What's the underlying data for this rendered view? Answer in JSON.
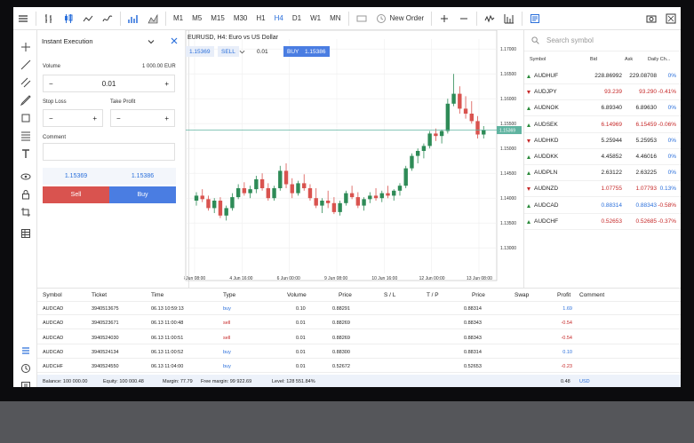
{
  "toolbar": {
    "timeframes": [
      "M1",
      "M5",
      "M15",
      "M30",
      "H1",
      "H4",
      "D1",
      "W1",
      "MN"
    ],
    "active_timeframe": "H4",
    "new_order": "New Order"
  },
  "order_panel": {
    "mode": "Instant Execution",
    "volume_label": "Volume",
    "volume_amount": "1 000.00 EUR",
    "volume_value": "0.01",
    "stop_loss_label": "Stop Loss",
    "take_profit_label": "Take Profit",
    "comment_label": "Comment",
    "bid": "1.15369",
    "ask": "1.15386",
    "sell_label": "Sell",
    "buy_label": "Buy"
  },
  "chart": {
    "title": "EURUSD, H4: Euro vs US Dollar",
    "sell_price": "1.15369",
    "sell_label": "SELL",
    "volume": "0.01",
    "buy_label": "BUY",
    "buy_price": "1.15386",
    "current_price_tag": "1.15369"
  },
  "chart_data": {
    "type": "candlestick",
    "title": "EURUSD, H4: Euro vs US Dollar",
    "y_ticks": [
      "1.17000",
      "1.16500",
      "1.16000",
      "1.15500",
      "1.15000",
      "1.14500",
      "1.14000",
      "1.13500",
      "1.13000"
    ],
    "x_ticks": [
      "3 Jun 08:00",
      "4 Jun 16:00",
      "6 Jun 00:00",
      "9 Jun 08:00",
      "10 Jun 16:00",
      "12 Jun 00:00",
      "13 Jun 08:00"
    ],
    "ylim": [
      1.127,
      1.172
    ],
    "candles": [
      [
        1.1395,
        1.1412,
        1.1385,
        1.1405
      ],
      [
        1.1405,
        1.1418,
        1.1392,
        1.1398
      ],
      [
        1.1398,
        1.1405,
        1.1375,
        1.138
      ],
      [
        1.138,
        1.14,
        1.137,
        1.1395
      ],
      [
        1.1395,
        1.1402,
        1.136,
        1.1365
      ],
      [
        1.1365,
        1.1385,
        1.1355,
        1.138
      ],
      [
        1.138,
        1.141,
        1.1375,
        1.1402
      ],
      [
        1.1402,
        1.1428,
        1.1398,
        1.142
      ],
      [
        1.142,
        1.1432,
        1.1405,
        1.141
      ],
      [
        1.141,
        1.1425,
        1.14,
        1.1418
      ],
      [
        1.1418,
        1.1445,
        1.141,
        1.1438
      ],
      [
        1.1438,
        1.145,
        1.1415,
        1.142
      ],
      [
        1.142,
        1.143,
        1.1395,
        1.14
      ],
      [
        1.14,
        1.1425,
        1.1395,
        1.142
      ],
      [
        1.142,
        1.1465,
        1.1415,
        1.1455
      ],
      [
        1.1455,
        1.147,
        1.142,
        1.1428
      ],
      [
        1.1428,
        1.144,
        1.14,
        1.141
      ],
      [
        1.141,
        1.1435,
        1.1405,
        1.143
      ],
      [
        1.143,
        1.1448,
        1.1415,
        1.142
      ],
      [
        1.142,
        1.1428,
        1.1395,
        1.14
      ],
      [
        1.14,
        1.142,
        1.138,
        1.1385
      ],
      [
        1.1385,
        1.14,
        1.137,
        1.1395
      ],
      [
        1.1395,
        1.1415,
        1.138,
        1.139
      ],
      [
        1.139,
        1.1402,
        1.1368,
        1.1372
      ],
      [
        1.1372,
        1.1395,
        1.1365,
        1.139
      ],
      [
        1.139,
        1.1415,
        1.1385,
        1.141
      ],
      [
        1.141,
        1.1425,
        1.1398,
        1.1402
      ],
      [
        1.1402,
        1.1412,
        1.138,
        1.1385
      ],
      [
        1.1385,
        1.1402,
        1.1375,
        1.1398
      ],
      [
        1.1398,
        1.1412,
        1.139,
        1.1405
      ],
      [
        1.1405,
        1.142,
        1.1395,
        1.14
      ],
      [
        1.14,
        1.1415,
        1.1392,
        1.141
      ],
      [
        1.141,
        1.1425,
        1.14,
        1.1405
      ],
      [
        1.1405,
        1.1418,
        1.1395,
        1.1415
      ],
      [
        1.1415,
        1.143,
        1.1405,
        1.1425
      ],
      [
        1.1425,
        1.1465,
        1.142,
        1.146
      ],
      [
        1.146,
        1.149,
        1.1455,
        1.1485
      ],
      [
        1.1485,
        1.15,
        1.147,
        1.1495
      ],
      [
        1.1495,
        1.151,
        1.148,
        1.1505
      ],
      [
        1.1505,
        1.1535,
        1.15,
        1.153
      ],
      [
        1.153,
        1.154,
        1.1515,
        1.1525
      ],
      [
        1.1525,
        1.1538,
        1.151,
        1.1535
      ],
      [
        1.1535,
        1.16,
        1.153,
        1.159
      ],
      [
        1.159,
        1.165,
        1.1585,
        1.161
      ],
      [
        1.161,
        1.1625,
        1.157,
        1.158
      ],
      [
        1.158,
        1.1605,
        1.156,
        1.157
      ],
      [
        1.157,
        1.1595,
        1.155,
        1.1555
      ],
      [
        1.1555,
        1.1565,
        1.152,
        1.1528
      ],
      [
        1.1528,
        1.1545,
        1.152,
        1.1537
      ]
    ]
  },
  "watchlist": {
    "search_placeholder": "Search symbol",
    "headers": [
      "Symbol",
      "Bid",
      "Ask",
      "Daily Ch..."
    ],
    "rows": [
      {
        "symbol": "AUDHUF",
        "bid": "228.86992",
        "ask": "229.08708",
        "change": "0%",
        "dir": "up",
        "color": "#222"
      },
      {
        "symbol": "AUDJPY",
        "bid": "93.239",
        "ask": "93.290",
        "change": "-0.41%",
        "dir": "dn",
        "color": "#c62828"
      },
      {
        "symbol": "AUDNOK",
        "bid": "6.89340",
        "ask": "6.89630",
        "change": "0%",
        "dir": "up",
        "color": "#222"
      },
      {
        "symbol": "AUDSEK",
        "bid": "6.14969",
        "ask": "6.15459",
        "change": "-0.06%",
        "dir": "up",
        "color": "#c62828"
      },
      {
        "symbol": "AUDHKD",
        "bid": "5.25944",
        "ask": "5.25953",
        "change": "0%",
        "dir": "dn",
        "color": "#222"
      },
      {
        "symbol": "AUDDKK",
        "bid": "4.45852",
        "ask": "4.46016",
        "change": "0%",
        "dir": "up",
        "color": "#222"
      },
      {
        "symbol": "AUDPLN",
        "bid": "2.63122",
        "ask": "2.63225",
        "change": "0%",
        "dir": "up",
        "color": "#222"
      },
      {
        "symbol": "AUDNZD",
        "bid": "1.07755",
        "ask": "1.07793",
        "change": "0.13%",
        "dir": "dn",
        "color": "#c62828"
      },
      {
        "symbol": "AUDCAD",
        "bid": "0.88314",
        "ask": "0.88343",
        "change": "-0.58%",
        "dir": "up",
        "color": "#2a6fdb"
      },
      {
        "symbol": "AUDCHF",
        "bid": "0.52653",
        "ask": "0.52685",
        "change": "-0.37%",
        "dir": "up",
        "color": "#c62828"
      }
    ]
  },
  "trades": {
    "headers": [
      "Symbol",
      "Ticket",
      "Time",
      "Type",
      "Volume",
      "Price",
      "S / L",
      "T / P",
      "Price",
      "Swap",
      "Profit",
      "Comment"
    ],
    "rows": [
      {
        "symbol": "AUDCAD",
        "ticket": "3940513675",
        "time": "06.13 10:59:13",
        "type": "buy",
        "volume": "0.10",
        "price": "0.88291",
        "cur": "0.88314",
        "profit": "1.69"
      },
      {
        "symbol": "AUDCAD",
        "ticket": "3940523671",
        "time": "06.13 11:00:48",
        "type": "sell",
        "volume": "0.01",
        "price": "0.88269",
        "cur": "0.88343",
        "profit": "-0.54"
      },
      {
        "symbol": "AUDCAD",
        "ticket": "3940524030",
        "time": "06.13 11:00:51",
        "type": "sell",
        "volume": "0.01",
        "price": "0.88269",
        "cur": "0.88343",
        "profit": "-0.54"
      },
      {
        "symbol": "AUDCAD",
        "ticket": "3940524134",
        "time": "06.13 11:00:52",
        "type": "buy",
        "volume": "0.01",
        "price": "0.88300",
        "cur": "0.88314",
        "profit": "0.10"
      },
      {
        "symbol": "AUDCHF",
        "ticket": "3940524550",
        "time": "06.13 11:04:00",
        "type": "buy",
        "volume": "0.01",
        "price": "0.52672",
        "cur": "0.52653",
        "profit": "-0.23"
      }
    ],
    "status": {
      "balance": "Balance: 100 000.00",
      "equity": "Equity: 100 000.48",
      "margin": "Margin: 77.79",
      "free_margin": "Free margin: 99 922.69",
      "level": "Level: 128 551.84%",
      "total_profit": "0.48",
      "currency": "USD"
    }
  }
}
